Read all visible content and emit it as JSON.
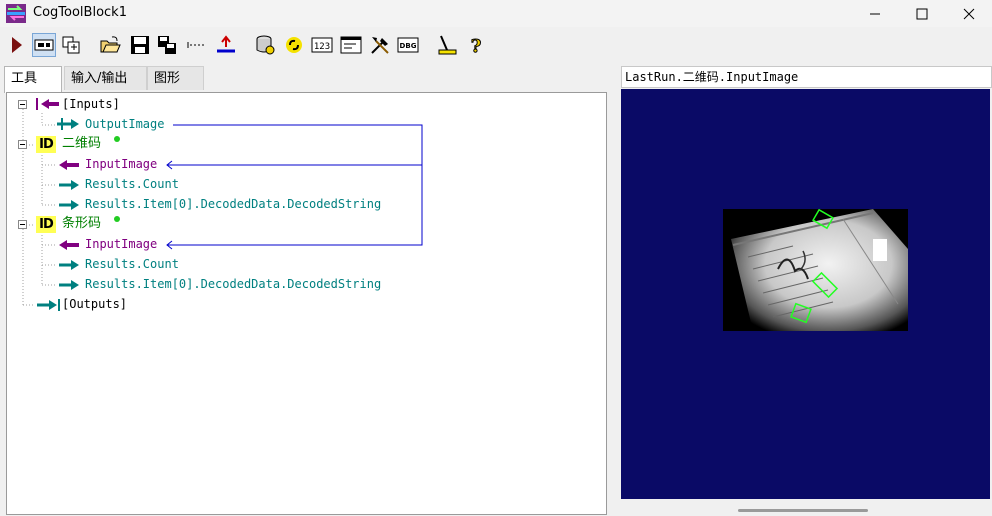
{
  "window": {
    "title": "CogToolBlock1"
  },
  "toolbar": {
    "buttons": [
      "run-icon",
      "display-toggle-icon",
      "add-tool-icon",
      "open-icon",
      "save-icon",
      "save-as-icon",
      "dotted-line-icon",
      "reset-icon",
      "database-icon",
      "link-icon",
      "number-display-icon",
      "terminal-icon",
      "tools-icon",
      "debug-icon",
      "edit-ruler-icon",
      "help-icon"
    ],
    "number_label": "123",
    "debug_label": "DBG"
  },
  "tabs": [
    {
      "label": "工具",
      "selected": true
    },
    {
      "label": "输入/输出",
      "selected": false
    },
    {
      "label": "图形",
      "selected": false
    }
  ],
  "tree": {
    "inputs_label": "[Inputs]",
    "output_image_label": "OutputImage",
    "tool1": {
      "name": "二维码",
      "icon_text": "ID",
      "input_image": "InputImage",
      "results_count": "Results.Count",
      "decoded_string": "Results.Item[0].DecodedData.DecodedString"
    },
    "tool2": {
      "name": "条形码",
      "icon_text": "ID",
      "input_image": "InputImage",
      "results_count": "Results.Count",
      "decoded_string": "Results.Item[0].DecodedData.DecodedString"
    },
    "outputs_label": "[Outputs]"
  },
  "image_panel": {
    "header": "LastRun.二维码.InputImage",
    "background_color": "#0a0a66"
  },
  "colors": {
    "teal": "#008080",
    "purple": "#800080",
    "link_line": "#0000cc",
    "tool_name": "#008000",
    "status_dot": "#22cc22"
  }
}
